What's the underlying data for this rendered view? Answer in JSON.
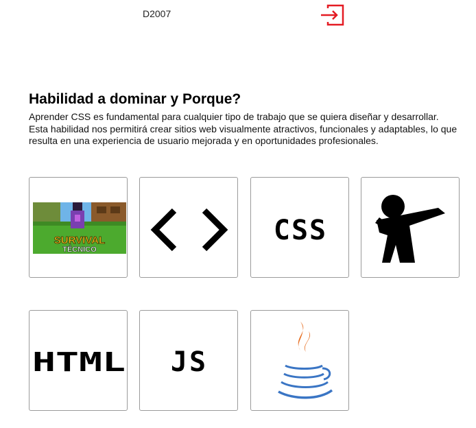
{
  "header": {
    "username": "D2007",
    "logout_icon": "logout-icon",
    "accent_color": "#e41b23"
  },
  "section": {
    "title": "Habilidad a dominar y Porque?",
    "description": "Aprender CSS es fundamental para cualquier tipo de trabajo que se quiera diseñar y desarrollar. Esta habilidad nos permitirá crear sitios web visualmente atractivos, funcionales y adaptables, lo que resulta en una experiencia de usuario mejorada y en oportunidades profesionales."
  },
  "cards": [
    {
      "icon": "survival-tecnico-thumbnail",
      "line1": "SURVIVAL",
      "line2": "TÉCNICO"
    },
    {
      "icon": "code-brackets-icon"
    },
    {
      "icon": "css-icon",
      "label": "CSS"
    },
    {
      "icon": "dab-person-icon"
    },
    {
      "icon": "html-icon",
      "label": "HTML"
    },
    {
      "icon": "js-icon",
      "label": "JS"
    },
    {
      "icon": "java-logo-icon"
    }
  ]
}
